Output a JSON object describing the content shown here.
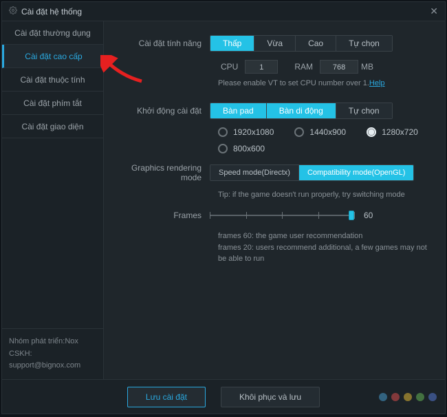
{
  "title": "Cài đặt hệ thống",
  "sidebar": {
    "items": [
      {
        "label": "Cài đặt thường dụng"
      },
      {
        "label": "Cài đặt cao cấp"
      },
      {
        "label": "Cài đặt thuộc tính"
      },
      {
        "label": "Cài đặt phím tắt"
      },
      {
        "label": "Cài đặt giao diện"
      }
    ],
    "footer_dev": "Nhóm phát triển:Nox",
    "footer_cskh": "CSKH:",
    "footer_email": "support@bignox.com"
  },
  "perf": {
    "label": "Cài đặt tính năng",
    "options": [
      "Thấp",
      "Vừa",
      "Cao",
      "Tự chọn"
    ],
    "cpu_label": "CPU",
    "cpu_value": "1",
    "ram_label": "RAM",
    "ram_value": "768",
    "mb": "MB",
    "vt_hint": "Please enable VT to set CPU number over 1.",
    "help": "Help"
  },
  "startup": {
    "label": "Khởi động cài đặt",
    "options": [
      "Bàn pad",
      "Bàn di động",
      "Tự chọn"
    ],
    "res": [
      "1920x1080",
      "1440x900",
      "1280x720",
      "800x600"
    ]
  },
  "graphics": {
    "label": "Graphics rendering mode",
    "modes": [
      "Speed mode(Directx)",
      "Compatibility mode(OpenGL)"
    ],
    "tip": "Tip: if the game doesn't run properly, try switching mode"
  },
  "frames": {
    "label": "Frames",
    "value": "60",
    "note1": "frames 60: the game user recommendation",
    "note2": "frames 20: users recommend additional, a few games may not be able to run"
  },
  "buttons": {
    "save": "Lưu cài đặt",
    "restore": "Khôi phục và lưu"
  },
  "dots": [
    "#4aa3d9",
    "#e94f4f",
    "#f2c335",
    "#6bbf59",
    "#5a7ee0"
  ]
}
